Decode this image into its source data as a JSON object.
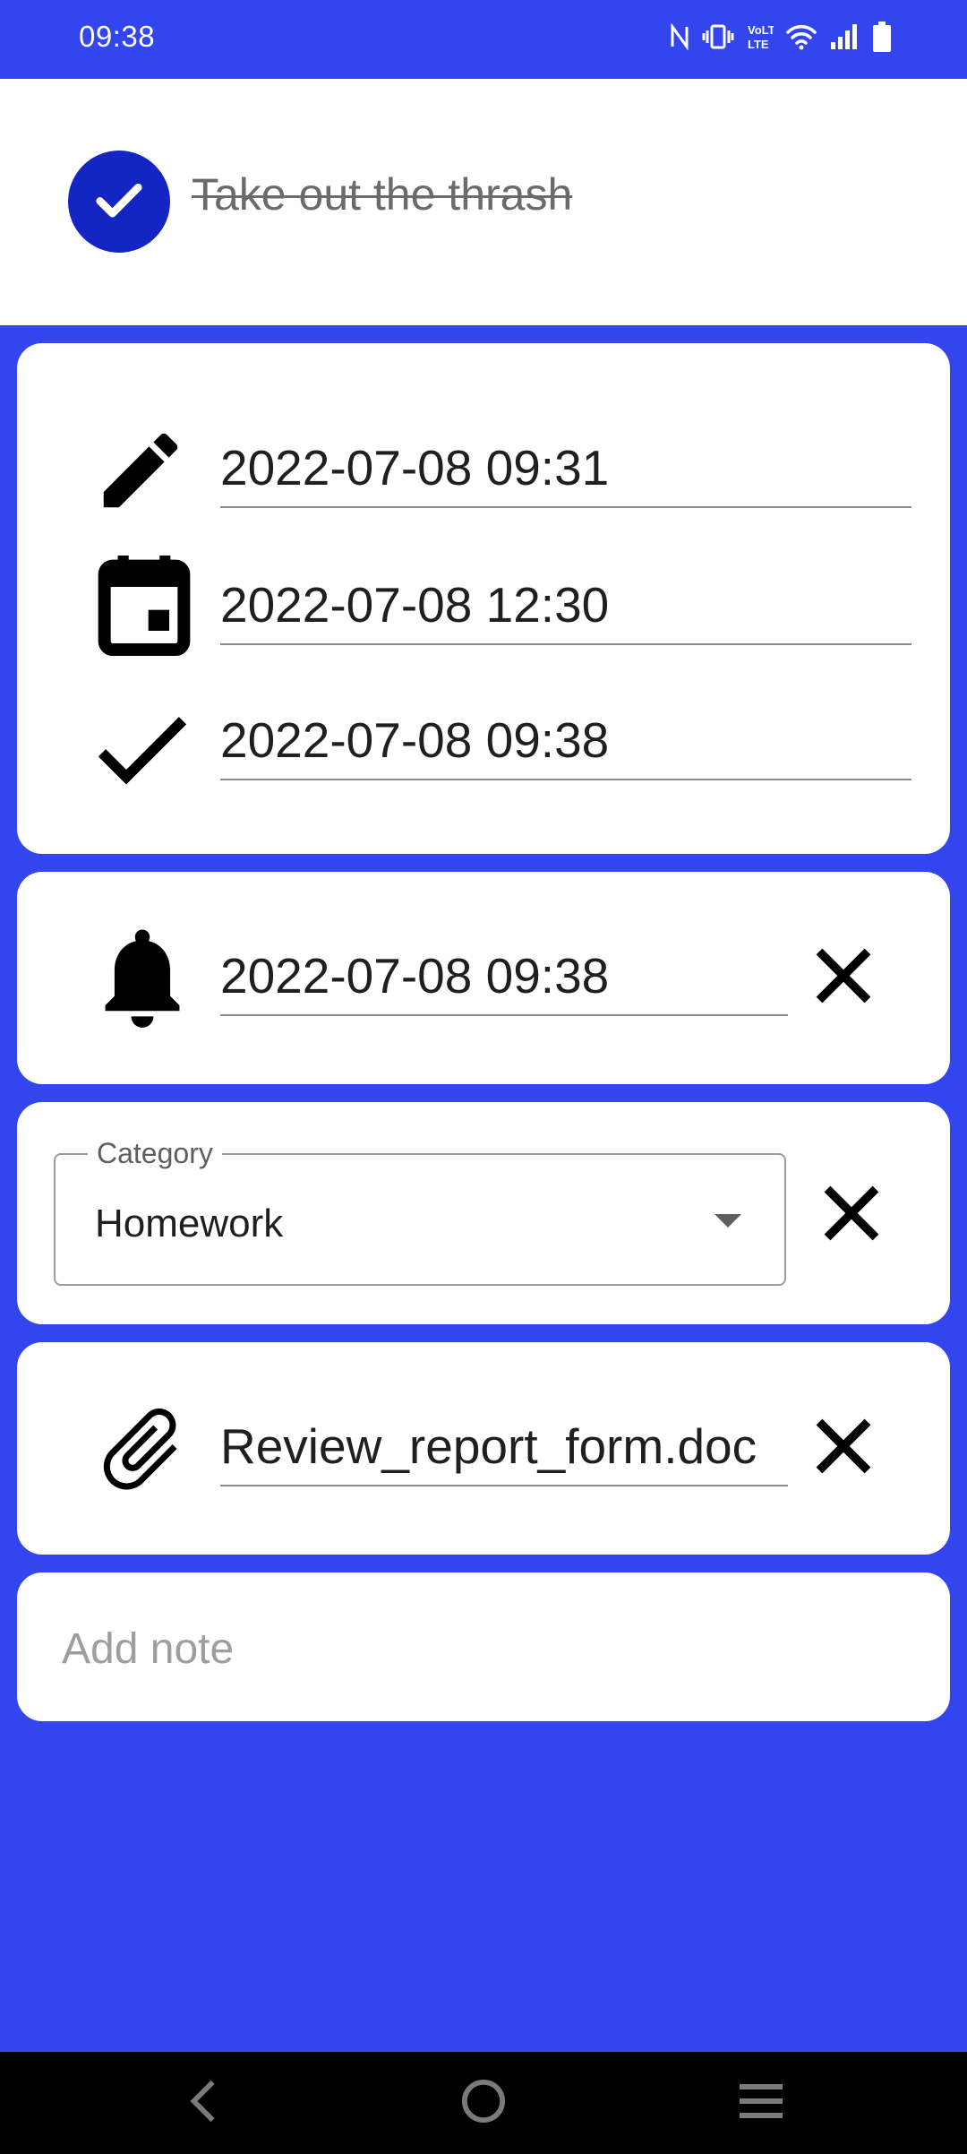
{
  "status_bar": {
    "time": "09:38",
    "icons": [
      "nfc-icon",
      "vibrate-icon",
      "volte-icon",
      "wifi-icon",
      "signal-icon",
      "battery-icon"
    ]
  },
  "task": {
    "title": "Take out the thrash",
    "completed": true
  },
  "dates": {
    "created": "2022-07-08 09:31",
    "due": "2022-07-08 12:30",
    "completed": "2022-07-08 09:38"
  },
  "reminder": {
    "datetime": "2022-07-08 09:38"
  },
  "category": {
    "label": "Category",
    "value": "Homework"
  },
  "attachment": {
    "filename": "Review_report_form.doc"
  },
  "note": {
    "placeholder": "Add note"
  },
  "colors": {
    "background": "#3346EE",
    "check_circle": "#1325C2",
    "card": "#FFFFFF",
    "nav_bar": "#000000"
  }
}
